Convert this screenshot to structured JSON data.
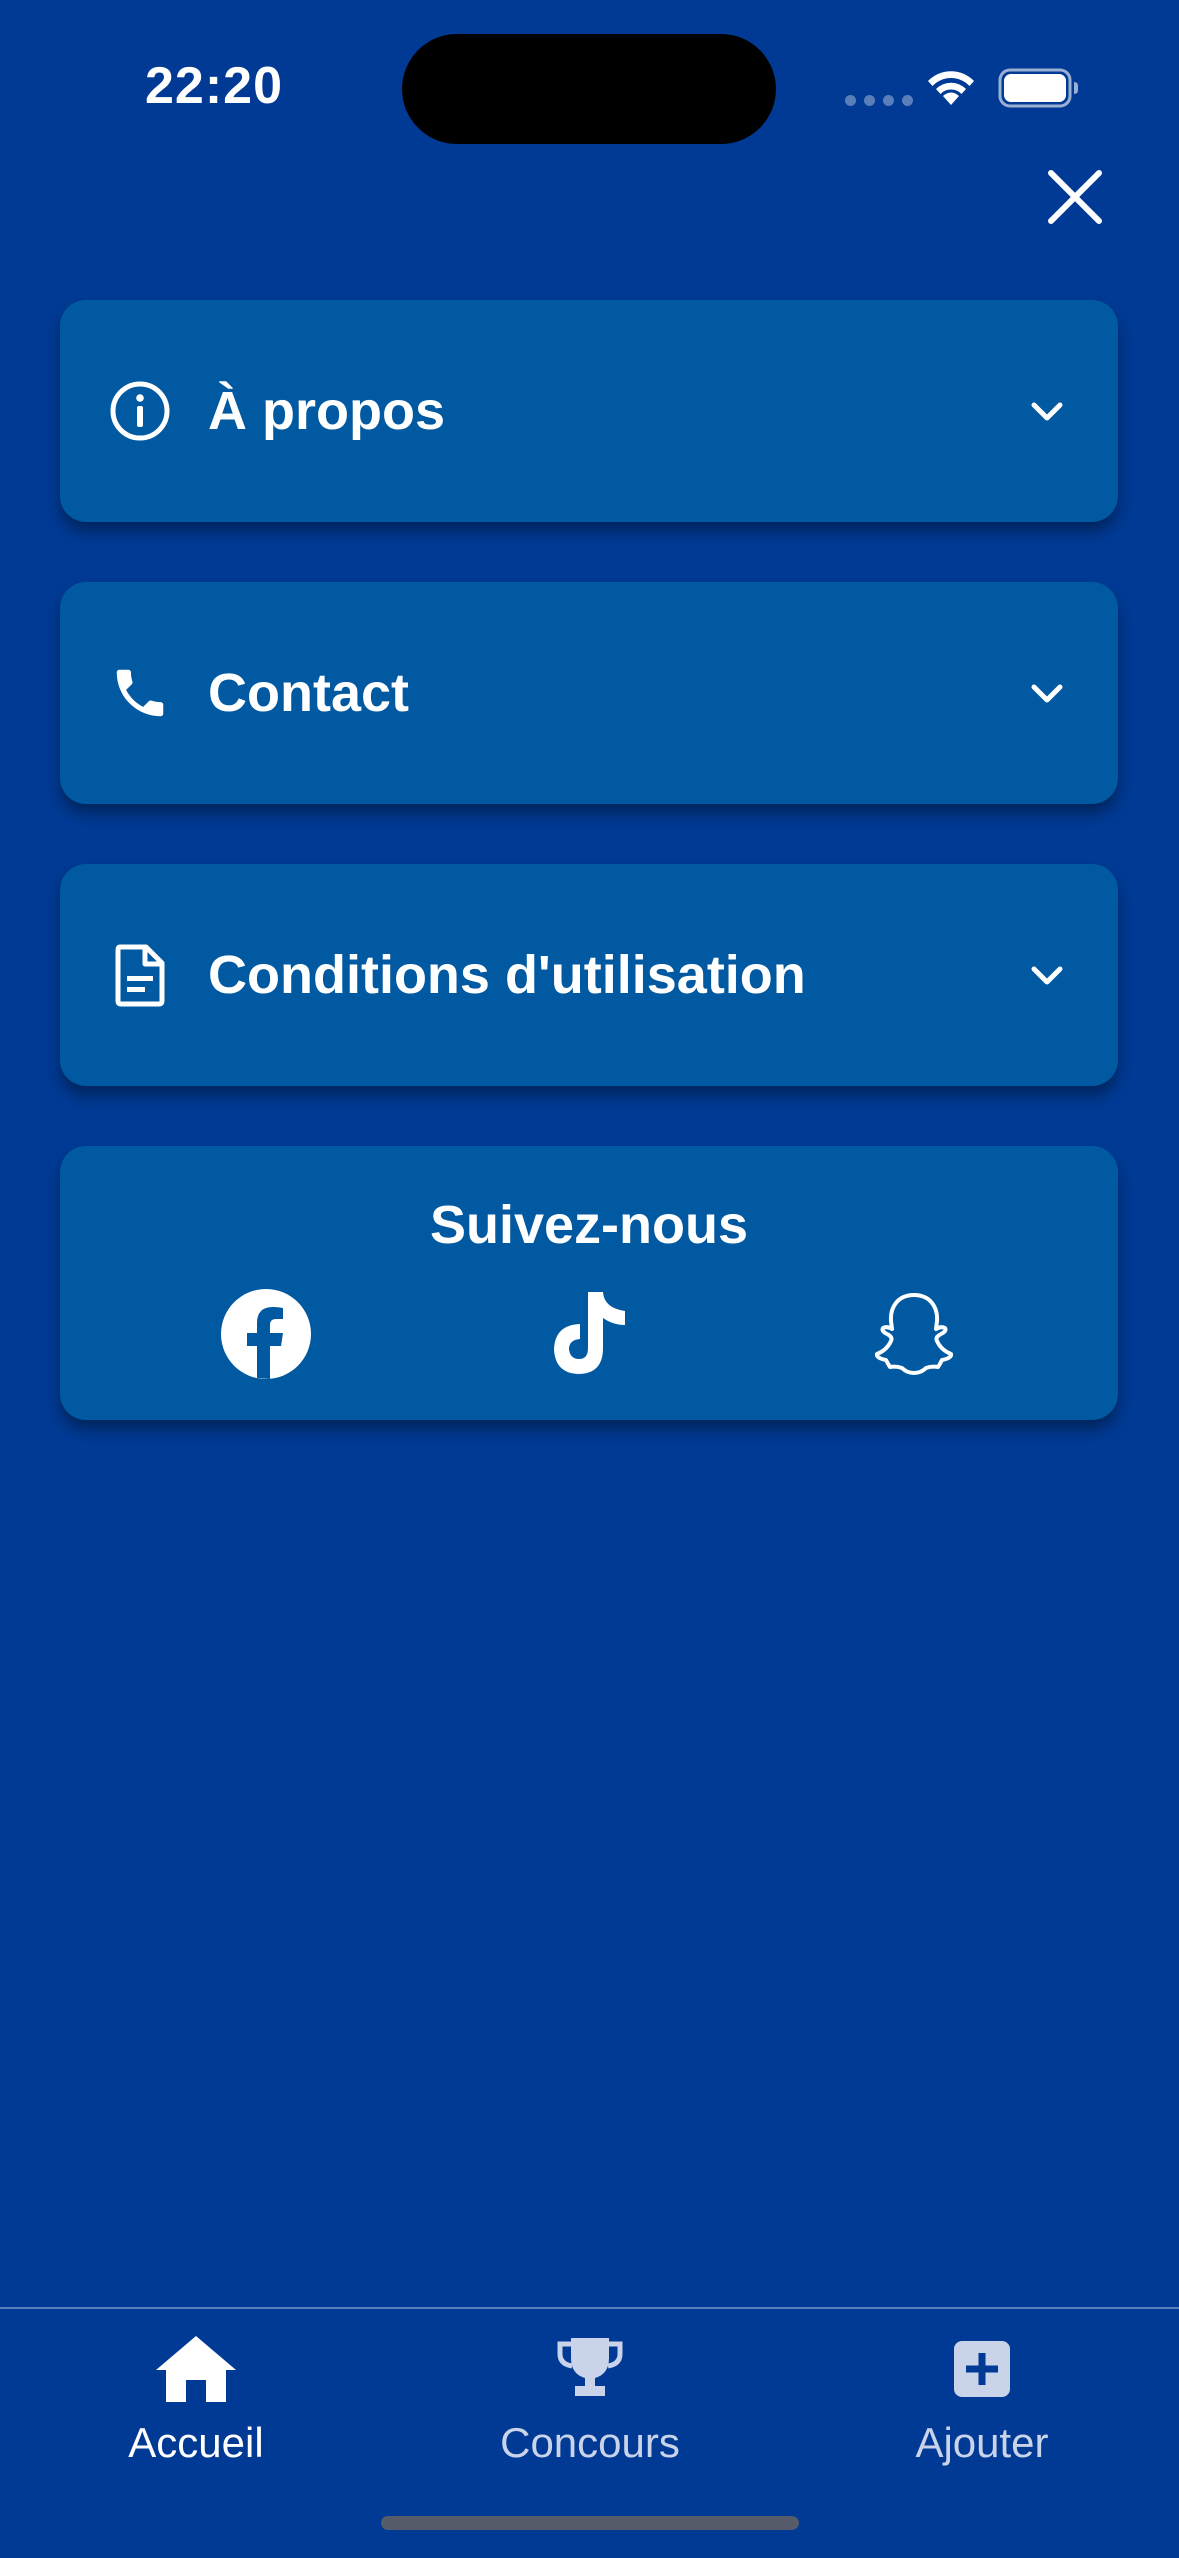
{
  "status_bar": {
    "time": "22:20"
  },
  "colors": {
    "background": "#003A94",
    "card": "#0159A1",
    "text": "#FFFFFF",
    "inactive_tab": "#C9D3EA"
  },
  "menu": {
    "close_icon": "close-icon",
    "sections": [
      {
        "icon": "info-icon",
        "label": "À propos",
        "expanded": false
      },
      {
        "icon": "phone-icon",
        "label": "Contact",
        "expanded": false
      },
      {
        "icon": "document-icon",
        "label": "Conditions d'utilisation",
        "expanded": false
      }
    ]
  },
  "social": {
    "title": "Suivez-nous",
    "networks": [
      {
        "icon": "facebook-icon"
      },
      {
        "icon": "tiktok-icon"
      },
      {
        "icon": "snapchat-icon"
      }
    ]
  },
  "tab_bar": {
    "tabs": [
      {
        "icon": "home-icon",
        "label": "Accueil",
        "active": true
      },
      {
        "icon": "trophy-icon",
        "label": "Concours",
        "active": false
      },
      {
        "icon": "add-icon",
        "label": "Ajouter",
        "active": false
      }
    ]
  }
}
